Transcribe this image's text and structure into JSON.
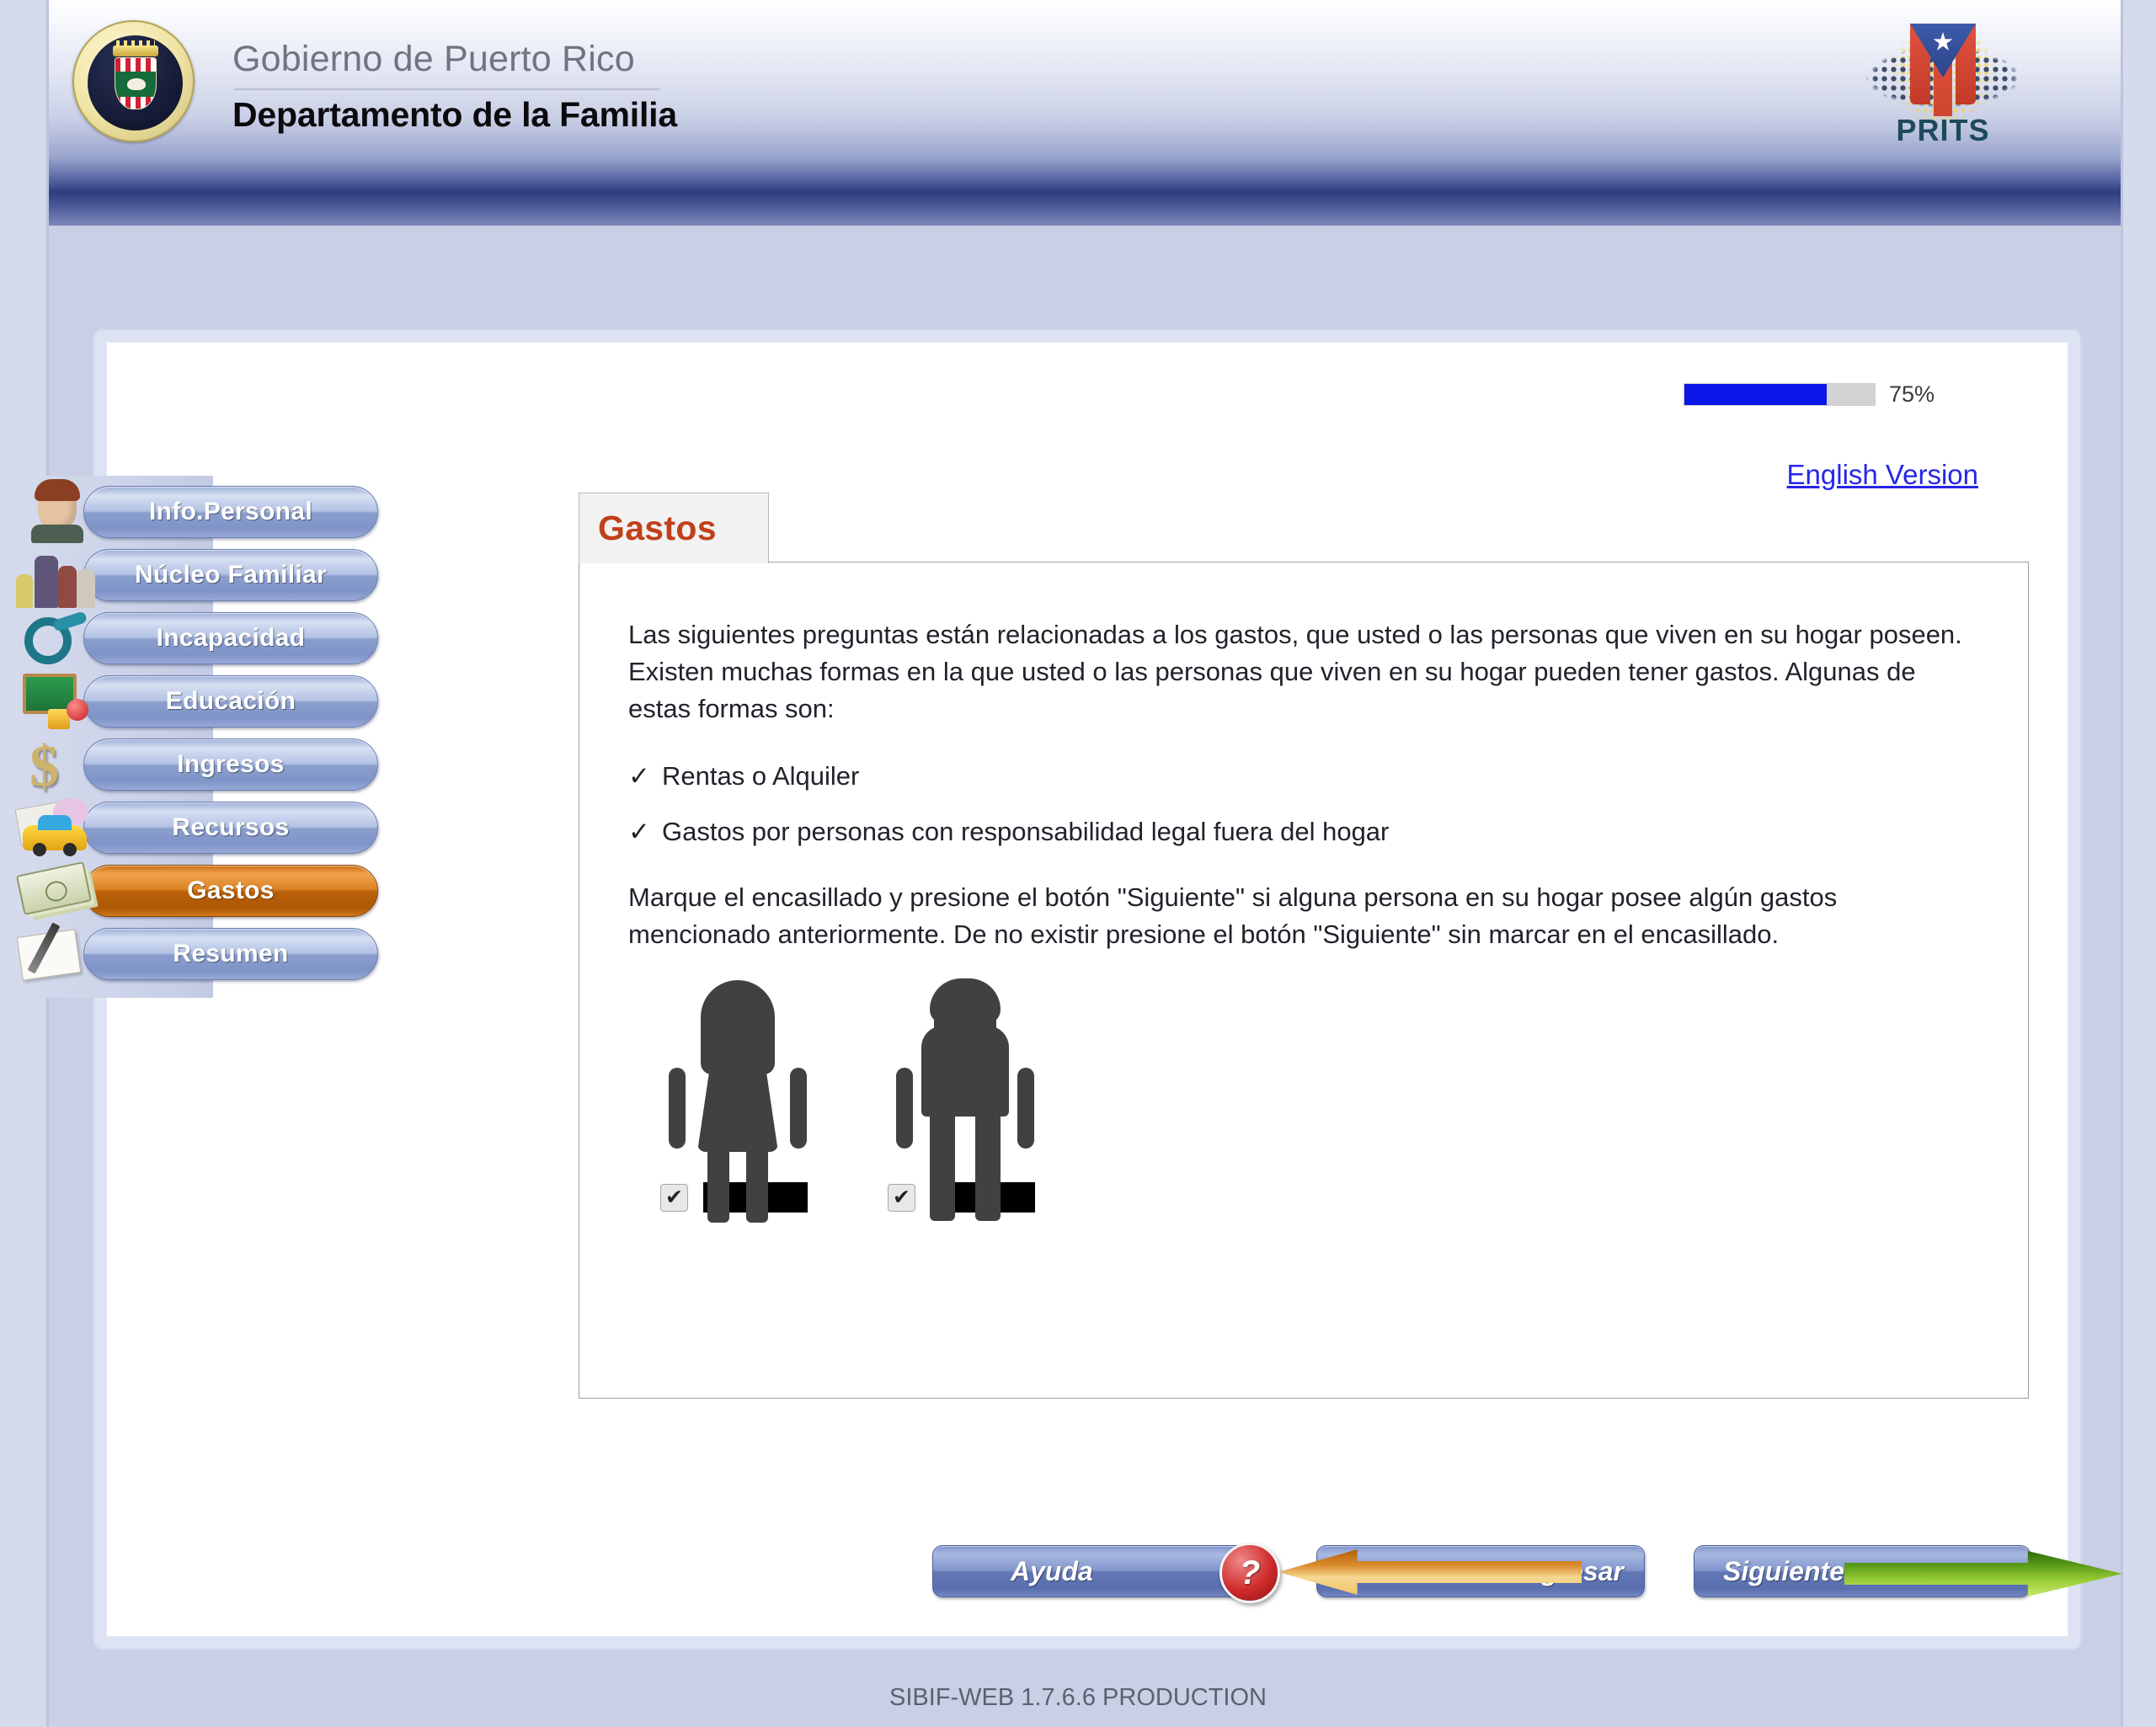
{
  "header": {
    "org_name": "Gobierno de Puerto Rico",
    "department": "Departamento de la Familia",
    "seal_alt": "Gobierno de Puerto Rico",
    "logo_text": "PRITS"
  },
  "progress": {
    "percent_label": "75%",
    "percent_value": 75,
    "fill_color": "#0b16e8",
    "track_color": "#d2d2d2"
  },
  "language_link": {
    "label": "English Version"
  },
  "sidebar": {
    "items": [
      {
        "label": "Info.Personal",
        "icon": "person-avatar-icon",
        "active": false
      },
      {
        "label": "Núcleo Familiar",
        "icon": "family-group-icon",
        "active": false
      },
      {
        "label": "Incapacidad",
        "icon": "wheelchair-icon",
        "active": false
      },
      {
        "label": "Educación",
        "icon": "chalkboard-icon",
        "active": false
      },
      {
        "label": "Ingresos",
        "icon": "dollar-sign-icon",
        "active": false
      },
      {
        "label": "Recursos",
        "icon": "car-piggybank-icon",
        "active": false
      },
      {
        "label": "Gastos",
        "icon": "cash-bills-icon",
        "active": true
      },
      {
        "label": "Resumen",
        "icon": "notepad-pen-icon",
        "active": false
      }
    ],
    "active_color": "#c96a12",
    "inactive_color": "#8a9ecd"
  },
  "card": {
    "tab_label": "Gastos",
    "tab_label_color": "#c0401a",
    "intro_paragraph": "Las siguientes preguntas están relacionadas a los gastos, que usted o las personas que viven en su hogar poseen. Existen muchas formas en la que usted o las personas que viven en su hogar pueden tener gastos. Algunas de estas formas son:",
    "check_mark": "✓",
    "bullets": [
      "Rentas o Alquiler",
      "Gastos por personas con responsabilidad legal fuera del hogar"
    ],
    "instruction_paragraph": "Marque el encasillado y presione el botón \"Siguiente\" si alguna persona en su hogar posee algún gastos mencionado anteriormente. De no existir presione el botón \"Siguiente\" sin marcar en el encasillado.",
    "people": [
      {
        "silhouette": "female-silhouette-icon",
        "checked": true,
        "check_glyph": "✔",
        "name_redacted": true
      },
      {
        "silhouette": "male-silhouette-icon",
        "checked": true,
        "check_glyph": "✔",
        "name_redacted": true
      }
    ]
  },
  "actions": {
    "help_label": "Ayuda",
    "help_badge": "?",
    "back_label": "Regresar",
    "next_label": "Siguiente"
  },
  "footer": {
    "version_text": "SIBIF-WEB 1.7.6.6 PRODUCTION"
  }
}
